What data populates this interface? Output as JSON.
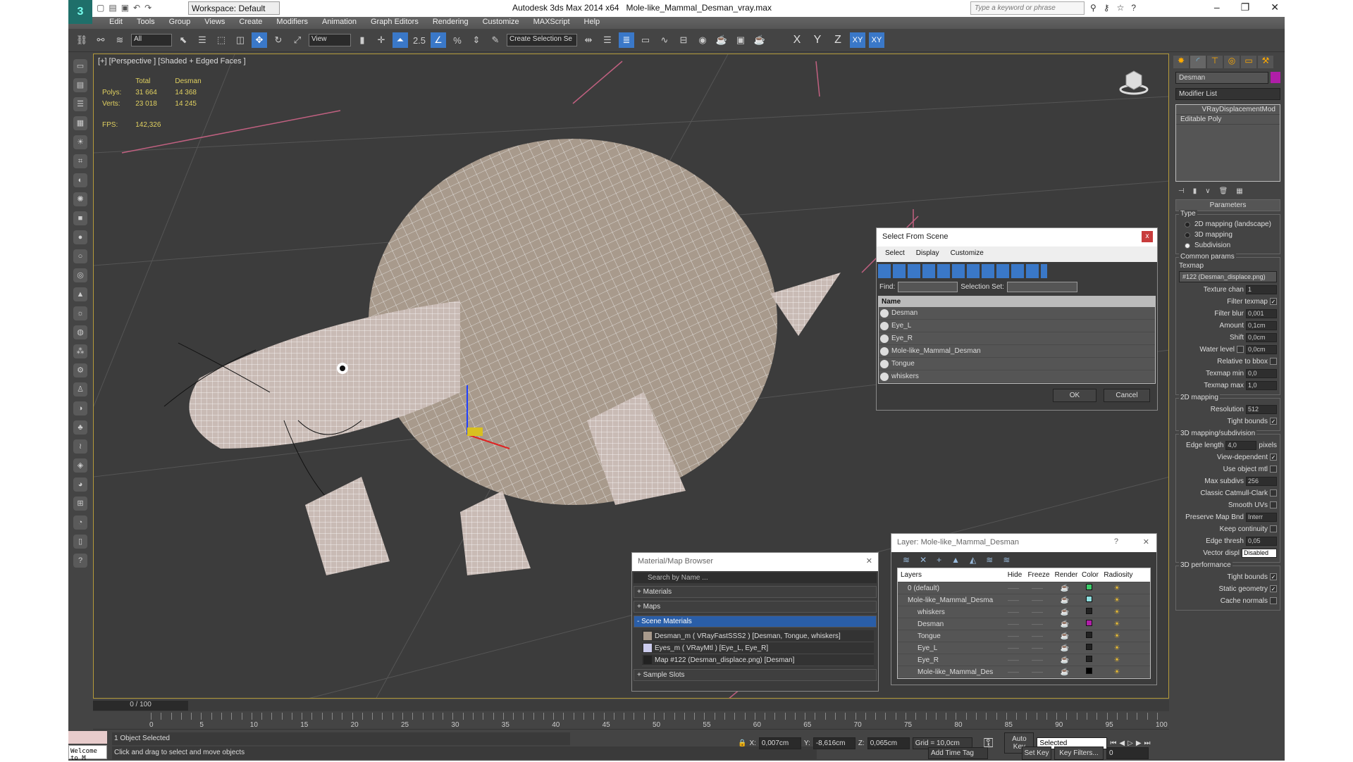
{
  "titlebar": {
    "workspace": "Workspace: Default",
    "app": "Autodesk 3ds Max  2014 x64",
    "file": "Mole-like_Mammal_Desman_vray.max",
    "search_placeholder": "Type a keyword or phrase",
    "minimize": "–",
    "restore": "❐",
    "close": "✕"
  },
  "menu": [
    "Edit",
    "Tools",
    "Group",
    "Views",
    "Create",
    "Modifiers",
    "Animation",
    "Graph Editors",
    "Rendering",
    "Customize",
    "MAXScript",
    "Help"
  ],
  "toolbar": {
    "filter": "All",
    "ref_coord": "View",
    "snap_angle": "2.5",
    "selection_set": "Create Selection Se",
    "axes": [
      "X",
      "Y",
      "Z",
      "XY",
      "XY"
    ]
  },
  "viewport": {
    "label": "[+] [Perspective ] [Shaded + Edged Faces ]",
    "stats": {
      "col_total": "Total",
      "col_obj": "Desman",
      "polys_label": "Polys:",
      "polys_total": "31 664",
      "polys_obj": "14 368",
      "verts_label": "Verts:",
      "verts_total": "23 018",
      "verts_obj": "14 245",
      "fps_label": "FPS:",
      "fps": "142,326"
    }
  },
  "command_panel": {
    "object_name": "Desman",
    "object_color": "#b01ea8",
    "modifier_list": "Modifier List",
    "stack": [
      "VRayDisplacementMod",
      "Editable Poly"
    ],
    "parameters": "Parameters",
    "type_label": "Type",
    "type_options": [
      "2D mapping (landscape)",
      "3D mapping",
      "Subdivision"
    ],
    "type_selected": "Subdivision",
    "common": "Common params",
    "texmap_label": "Texmap",
    "texmap": "#122 (Desman_displace.png)",
    "rows": [
      {
        "label": "Texture chan",
        "value": "1"
      },
      {
        "label": "Filter texmap",
        "check": true
      },
      {
        "label": "Filter blur",
        "value": "0,001"
      },
      {
        "label": "Amount",
        "value": "0,1cm"
      },
      {
        "label": "Shift",
        "value": "0,0cm"
      },
      {
        "label": "Water level",
        "value": "0,0cm",
        "check": false
      },
      {
        "label": "Relative to bbox",
        "check": false
      },
      {
        "label": "Texmap min",
        "value": "0,0"
      },
      {
        "label": "Texmap max",
        "value": "1,0"
      }
    ],
    "map2d": "2D mapping",
    "map2d_rows": [
      {
        "label": "Resolution",
        "value": "512"
      },
      {
        "label": "Tight bounds",
        "check": true
      }
    ],
    "map3d": "3D mapping/subdivision",
    "map3d_rows": [
      {
        "label": "Edge length",
        "value": "4,0",
        "suffix": "pixels"
      },
      {
        "label": "View-dependent",
        "check": true
      },
      {
        "label": "Use object mtl",
        "check": false
      },
      {
        "label": "Max subdivs",
        "value": "256"
      },
      {
        "label": "Classic Catmull-Clark",
        "check": false
      },
      {
        "label": "Smooth UVs",
        "check": false
      },
      {
        "label": "Preserve Map Bnd",
        "value": "Interr"
      },
      {
        "label": "Keep continuity",
        "check": false
      },
      {
        "label": "Edge thresh",
        "value": "0,05"
      },
      {
        "label": "Vector displ",
        "value": "Disabled"
      }
    ],
    "perf": "3D performance",
    "perf_rows": [
      {
        "label": "Tight bounds",
        "check": true
      },
      {
        "label": "Static geometry",
        "check": true
      },
      {
        "label": "Cache normals",
        "check": false
      }
    ]
  },
  "select_dialog": {
    "title": "Select From Scene",
    "close": "x",
    "menu": [
      "Select",
      "Display",
      "Customize"
    ],
    "find_label": "Find:",
    "selset_label": "Selection Set:",
    "col_name": "Name",
    "items": [
      "Desman",
      "Eye_L",
      "Eye_R",
      "Mole-like_Mammal_Desman",
      "Tongue",
      "whiskers"
    ],
    "ok": "OK",
    "cancel": "Cancel"
  },
  "material_browser": {
    "title": "Material/Map Browser",
    "close": "✕",
    "search_placeholder": "Search by Name ...",
    "sections": [
      "+ Materials",
      "+ Maps",
      "- Scene Materials"
    ],
    "items": [
      "Desman_m  ( VRayFastSSS2 )  [Desman, Tongue, whiskers]",
      "Eyes_m  ( VRayMtl )  [Eye_L, Eye_R]",
      "Map #122 (Desman_displace.png)  [Desman]"
    ],
    "sample": "+ Sample Slots"
  },
  "layer_dialog": {
    "title": "Layer: Mole-like_Mammal_Desman",
    "help": "?",
    "close": "✕",
    "cols": [
      "Layers",
      "Hide",
      "Freeze",
      "Render",
      "Color",
      "Radiosity"
    ],
    "rows": [
      {
        "name": "0 (default)",
        "color": "#3ccc6a",
        "indent": 1
      },
      {
        "name": "Mole-like_Mammal_Desma",
        "color": "#8ee0e0",
        "indent": 1
      },
      {
        "name": "whiskers",
        "color": "#222222",
        "indent": 2
      },
      {
        "name": "Desman",
        "color": "#b01ea8",
        "indent": 2
      },
      {
        "name": "Tongue",
        "color": "#222222",
        "indent": 2
      },
      {
        "name": "Eye_L",
        "color": "#222222",
        "indent": 2
      },
      {
        "name": "Eye_R",
        "color": "#222222",
        "indent": 2
      },
      {
        "name": "Mole-like_Mammal_Des",
        "color": "#000000",
        "indent": 2
      }
    ]
  },
  "timeline": {
    "frame": "0 / 100",
    "ticks": [
      "0",
      "5",
      "10",
      "15",
      "20",
      "25",
      "30",
      "35",
      "40",
      "45",
      "50",
      "55",
      "60",
      "65",
      "70",
      "75",
      "80",
      "85",
      "90",
      "95",
      "100"
    ]
  },
  "status": {
    "selected": "1 Object Selected",
    "prompt": "Click and drag to select and move objects",
    "welcome": "Welcome to M",
    "x_label": "X:",
    "x": "0,007cm",
    "y_label": "Y:",
    "y": "-8,616cm",
    "z_label": "Z:",
    "z": "0,065cm",
    "grid": "Grid = 10,0cm",
    "add_time_tag": "Add Time Tag",
    "auto_key": "Auto Key",
    "set_key": "Set Key",
    "key_mode": "Selected",
    "key_filters": "Key Filters...",
    "current_frame": "0"
  }
}
